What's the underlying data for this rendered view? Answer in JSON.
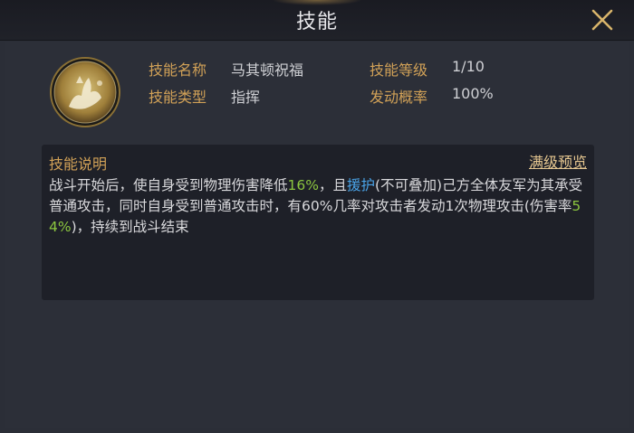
{
  "title": "技能",
  "close_icon": "close-icon",
  "skill": {
    "icon": "skill-emblem-icon",
    "name_label": "技能名称",
    "name_value": "马其顿祝福",
    "level_label": "技能等级",
    "level_value": "1/10",
    "type_label": "技能类型",
    "type_value": "指挥",
    "rate_label": "发动概率",
    "rate_value": "100%"
  },
  "description": {
    "title": "技能说明",
    "preview_link": "满级预览",
    "seg1": "战斗开始后，使自身受到物理伤害降低",
    "val1": "16%",
    "seg2": "，且",
    "keyword": "援护",
    "seg3": "(不可叠加)己方全体友军为其承受普通攻击，同时自身受到普通攻击时，有60%几率对攻击者发动1次物理攻击(伤害率",
    "val2": "54%",
    "seg4": ")，持续到战斗结束"
  },
  "colors": {
    "label_gold": "#d1a157",
    "highlight_green": "#8cc63f",
    "highlight_blue": "#4aa4e8",
    "background": "#2b2e37"
  }
}
